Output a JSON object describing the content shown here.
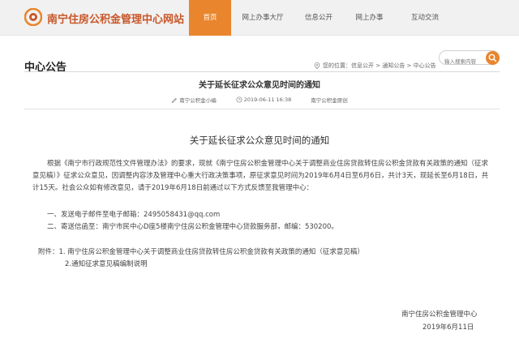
{
  "header": {
    "site_title": "南宁住房公积金管理中心网站",
    "nav": [
      "首页",
      "网上办事大厅",
      "信息公开",
      "网上办事",
      "互动交流"
    ],
    "accent": "#e9852c"
  },
  "section": {
    "title": "中心公告",
    "breadcrumb": "您的位置：信息公开 > 通知公告 > 中心公告",
    "search_placeholder": "输入搜索内容"
  },
  "article": {
    "title": "关于延长征求公众意见时间的通知",
    "author": "南宁公积金小编",
    "date": "2019-06-11 16:38",
    "source": "南宁公积金原创",
    "subtitle": "关于延长征求公众意见时间的通知",
    "paragraph1": "根据《南宁市行政规范性文件管理办法》的要求，现就《南宁住房公积金管理中心关于调整商业住房贷款转住房公积金贷款有关政策的通知（征求意见稿）》征求公众意见，因调整内容涉及管理中心重大行政决策事项，原征求意见时间为2019年6月4日至6月6日，共计3天，现延长至6月18日，共计15天。社会公众如有修改意见，请于2019年6月18日前通过以下方式反馈至我管理中心：",
    "item1": "一、发送电子邮件至电子邮箱：2495058431@qq.com",
    "item2": "二、寄送信函至：南宁市民中心D座5楼南宁住房公积金管理中心贷款服务部，邮编：530200。",
    "attach1": "附件：1. 南宁住房公积金管理中心关于调整商业住房贷款转住房公积金贷款有关政策的通知（征求意见稿）",
    "attach2": "2.通知征求意见稿编制说明",
    "sign_org": "南宁住房公积金管理中心",
    "sign_date": "2019年6月11日"
  }
}
